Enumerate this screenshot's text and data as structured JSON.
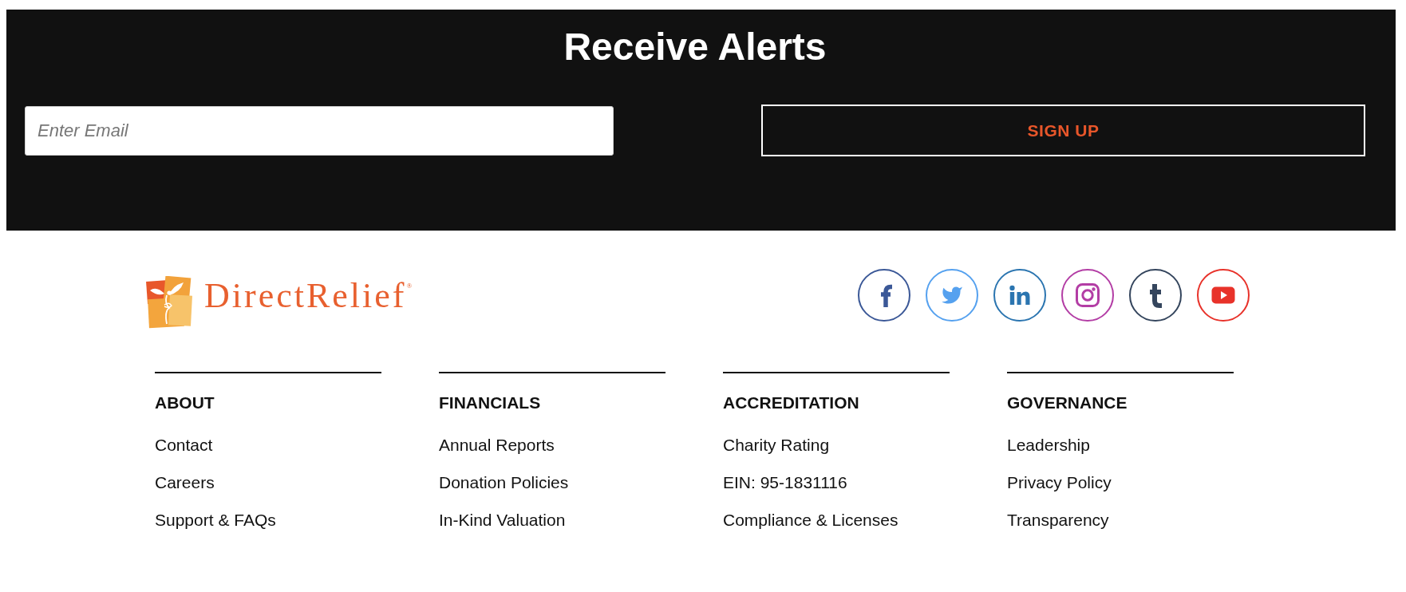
{
  "alerts": {
    "title": "Receive Alerts",
    "email": {
      "placeholder": "Enter Email"
    },
    "button": "SIGN UP"
  },
  "footer": {
    "logo": {
      "text": "DirectRelief$^{®}$"
    },
    "social": [
      {
        "kind": "facebook",
        "color": "#3b5897"
      },
      {
        "kind": "twitter",
        "color": "#55a1ef"
      },
      {
        "kind": "linkedin",
        "color": "#2b75b0"
      },
      {
        "kind": "instagram",
        "color": "#b33da5"
      },
      {
        "kind": "tumblr",
        "color": "#34455d"
      },
      {
        "kind": "youtube",
        "color": "#e8322a"
      }
    ],
    "columns": [
      {
        "heading": "ABOUT",
        "links": [
          "Contact",
          "Careers",
          "Support & FAQs"
        ]
      },
      {
        "heading": "FINANCIALS",
        "links": [
          "Annual Reports",
          "Donation Policies",
          "In-Kind Valuation"
        ]
      },
      {
        "heading": "ACCREDITATION",
        "links": [
          "Charity Rating",
          "EIN: 95-1831116",
          "Compliance & Licenses"
        ]
      },
      {
        "heading": "GOVERNANCE",
        "links": [
          "Leadership",
          "Privacy Policy",
          "Transparency"
        ]
      }
    ]
  }
}
